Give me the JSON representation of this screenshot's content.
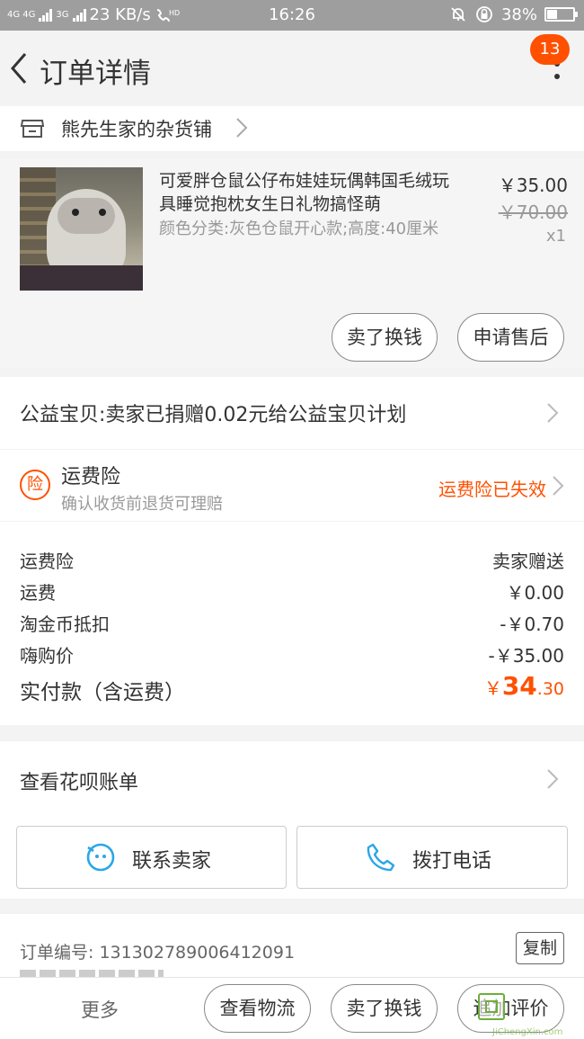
{
  "status_bar": {
    "network": "4G 4G",
    "network2": "3G",
    "speed": "23 KB/s",
    "hd": "HD",
    "time": "16:26",
    "battery": "38%",
    "battery_level": 0.38
  },
  "nav": {
    "title": "订单详情",
    "badge_count": "13"
  },
  "shop": {
    "name": "熊先生家的杂货铺"
  },
  "item": {
    "title": "可爱胖仓鼠公仔布娃娃玩偶韩国毛绒玩具睡觉抱枕女生日礼物搞怪萌",
    "sku": "颜色分类:灰色仓鼠开心款;高度:40厘米",
    "price": "￥35.00",
    "original_price": "￥70.00",
    "quantity": "x1",
    "sell_button": "卖了换钱",
    "after_sale_button": "申请售后"
  },
  "charity": {
    "text": "公益宝贝:卖家已捐赠0.02元给公益宝贝计划"
  },
  "insurance": {
    "icon_text": "险",
    "title": "运费险",
    "subtitle": "确认收货前退货可理赔",
    "status": "运费险已失效"
  },
  "fees": [
    {
      "label": "运费险",
      "value": "卖家赠送"
    },
    {
      "label": "运费",
      "value": "￥0.00"
    },
    {
      "label": "淘金币抵扣",
      "value": "-￥0.70"
    },
    {
      "label": "嗨购价",
      "value": "-￥35.00"
    }
  ],
  "total": {
    "label": "实付款（含运费）",
    "currency": "￥",
    "amount_int": "34",
    "amount_dec": ".30"
  },
  "huabei": {
    "text": "查看花呗账单"
  },
  "contact": {
    "seller_label": "联系卖家",
    "call_label": "拨打电话"
  },
  "order": {
    "number_text": "订单编号: 131302789006412091",
    "copy_label": "复制"
  },
  "bottom_bar": {
    "more": "更多",
    "logistics": "查看物流",
    "sell": "卖了换钱",
    "review": "追加评价"
  },
  "watermark": {
    "text": "JiChengXin.com"
  },
  "colors": {
    "accent": "#ff5000",
    "status_bar": "#9e9e9e",
    "icon_blue": "#2aa7e8"
  }
}
